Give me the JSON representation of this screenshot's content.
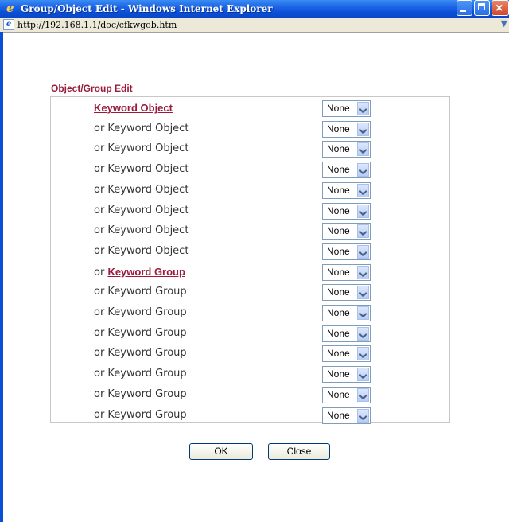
{
  "window": {
    "title": "Group/Object Edit - Windows Internet Explorer"
  },
  "address": {
    "url": "http://192.168.1.1/doc/cfkwgob.htm"
  },
  "page": {
    "heading": "Object/Group Edit"
  },
  "rows": [
    {
      "prefix": "",
      "label": "",
      "link": "Keyword Object",
      "value": "None"
    },
    {
      "prefix": "",
      "label": "or Keyword Object",
      "link": "",
      "value": "None"
    },
    {
      "prefix": "",
      "label": "or Keyword Object",
      "link": "",
      "value": "None"
    },
    {
      "prefix": "",
      "label": "or Keyword Object",
      "link": "",
      "value": "None"
    },
    {
      "prefix": "",
      "label": "or Keyword Object",
      "link": "",
      "value": "None"
    },
    {
      "prefix": "",
      "label": "or Keyword Object",
      "link": "",
      "value": "None"
    },
    {
      "prefix": "",
      "label": "or Keyword Object",
      "link": "",
      "value": "None"
    },
    {
      "prefix": "",
      "label": "or Keyword Object",
      "link": "",
      "value": "None"
    },
    {
      "prefix": "or ",
      "label": "",
      "link": "Keyword Group",
      "value": "None"
    },
    {
      "prefix": "",
      "label": "or Keyword Group",
      "link": "",
      "value": "None"
    },
    {
      "prefix": "",
      "label": "or Keyword Group",
      "link": "",
      "value": "None"
    },
    {
      "prefix": "",
      "label": "or Keyword Group",
      "link": "",
      "value": "None"
    },
    {
      "prefix": "",
      "label": "or Keyword Group",
      "link": "",
      "value": "None"
    },
    {
      "prefix": "",
      "label": "or Keyword Group",
      "link": "",
      "value": "None"
    },
    {
      "prefix": "",
      "label": "or Keyword Group",
      "link": "",
      "value": "None"
    },
    {
      "prefix": "",
      "label": "or Keyword Group",
      "link": "",
      "value": "None"
    }
  ],
  "buttons": {
    "ok": "OK",
    "close": "Close"
  },
  "icons": {
    "browser": "ie-icon",
    "page": "ie-page-icon",
    "dropdown": "chevron-down-icon"
  },
  "colors": {
    "titlebar": "#0b4fd6",
    "heading": "#9b1b3b",
    "link": "#9b1b3b"
  }
}
